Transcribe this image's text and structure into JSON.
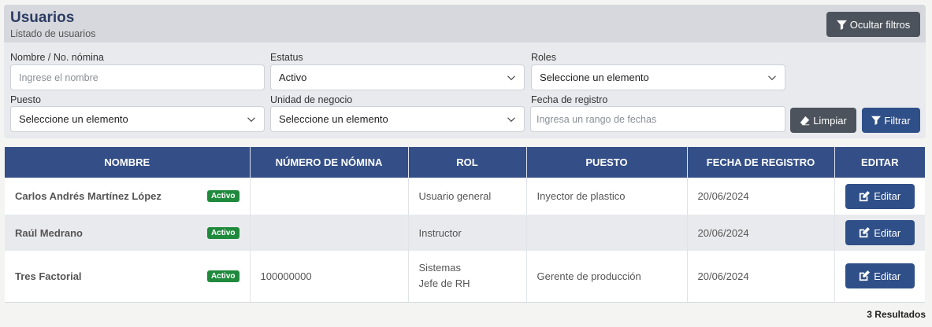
{
  "header": {
    "title": "Usuarios",
    "subtitle": "Listado de usuarios",
    "toggle_filters_label": "Ocultar filtros"
  },
  "filters": {
    "name": {
      "label": "Nombre / No. nómina",
      "placeholder": "Ingrese el nombre",
      "value": ""
    },
    "status": {
      "label": "Estatus",
      "value": "Activo"
    },
    "roles": {
      "label": "Roles",
      "value": "Seleccione un elemento"
    },
    "position": {
      "label": "Puesto",
      "value": "Seleccione un elemento"
    },
    "business_unit": {
      "label": "Unidad de negocio",
      "value": "Seleccione un elemento"
    },
    "date": {
      "label": "Fecha de registro",
      "placeholder": "Ingresa un rango de fechas",
      "value": ""
    },
    "clear_label": "Limpiar",
    "filter_label": "Filtrar"
  },
  "table": {
    "columns": [
      "NOMBRE",
      "NÚMERO DE NÓMINA",
      "ROL",
      "PUESTO",
      "FECHA DE REGISTRO",
      "EDITAR"
    ],
    "rows": [
      {
        "name": "Carlos Andrés Martínez López",
        "status": "Activo",
        "payroll": "",
        "roles": [
          "Usuario general"
        ],
        "position": "Inyector de plastico",
        "date": "20/06/2024",
        "edit": "Editar"
      },
      {
        "name": "Raúl Medrano",
        "status": "Activo",
        "payroll": "",
        "roles": [
          "Instructor"
        ],
        "position": "",
        "date": "20/06/2024",
        "edit": "Editar"
      },
      {
        "name": "Tres Factorial",
        "status": "Activo",
        "payroll": "100000000",
        "roles": [
          "Sistemas",
          "Jefe de RH"
        ],
        "position": "Gerente de producción",
        "date": "20/06/2024",
        "edit": "Editar"
      }
    ]
  },
  "footer": {
    "results": "3 Resultados"
  },
  "colors": {
    "primary": "#344f87",
    "dark_button": "#4c535c",
    "badge_green": "#1f8a3c"
  }
}
